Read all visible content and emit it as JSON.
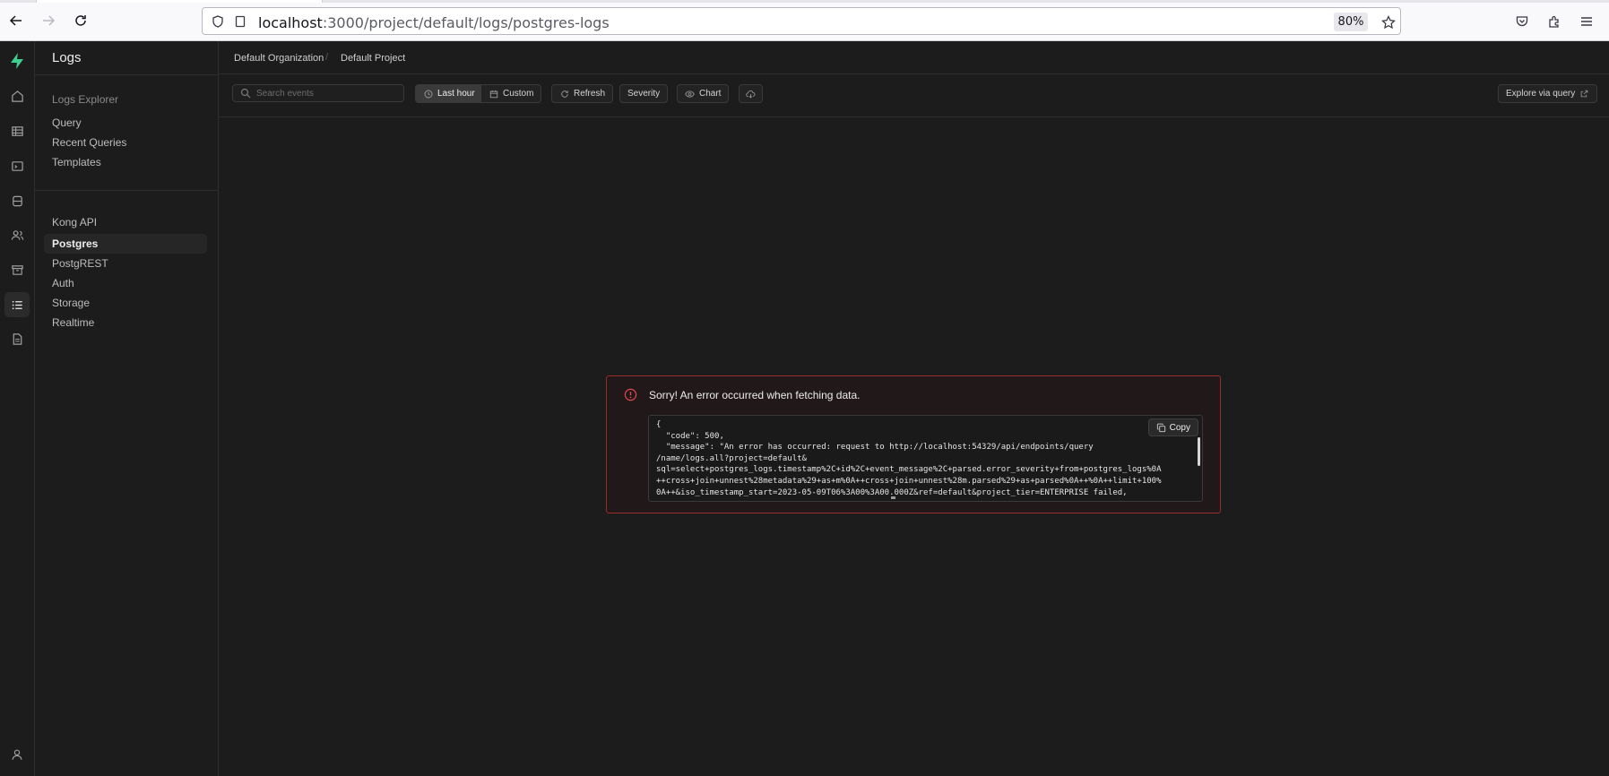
{
  "browser": {
    "url_host": "localhost",
    "url_path": ":3000/project/default/logs/postgres-logs",
    "zoom": "80%"
  },
  "sidebar": {
    "title": "Logs",
    "section_label": "Logs Explorer",
    "explorer_items": [
      {
        "label": "Query"
      },
      {
        "label": "Recent Queries"
      },
      {
        "label": "Templates"
      }
    ],
    "source_items": [
      {
        "label": "Kong API"
      },
      {
        "label": "Postgres"
      },
      {
        "label": "PostgREST"
      },
      {
        "label": "Auth"
      },
      {
        "label": "Storage"
      },
      {
        "label": "Realtime"
      }
    ]
  },
  "breadcrumb": {
    "org": "Default Organization",
    "project": "Default Project"
  },
  "toolbar": {
    "search_placeholder": "Search events",
    "last_hour_label": "Last hour",
    "custom_label": "Custom",
    "refresh_label": "Refresh",
    "severity_label": "Severity",
    "chart_label": "Chart",
    "explore_label": "Explore via query"
  },
  "error": {
    "title": "Sorry! An error occurred when fetching data.",
    "copy_label": "Copy",
    "body": "{\n  \"code\": 500,\n  \"message\": \"An error has occurred: request to http://localhost:54329/api/endpoints/query\n/name/logs.all?project=default&\nsql=select+postgres_logs.timestamp%2C+id%2C+event_message%2C+parsed.error_severity+from+postgres_logs%0A\n++cross+join+unnest%28metadata%29+as+m%0A++cross+join+unnest%28m.parsed%29+as+parsed%0A++%0A++limit+100%\n0A++&iso_timestamp_start=2023-05-09T06%3A00%3A00.000Z&ref=default&project_tier=ENTERPRISE failed,"
  }
}
